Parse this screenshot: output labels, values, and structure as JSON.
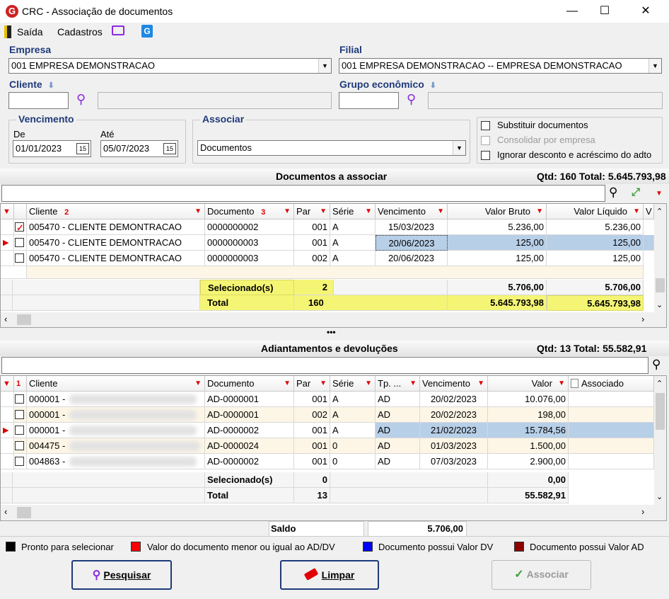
{
  "window": {
    "title": "CRC - Associação de documentos",
    "logo": "G"
  },
  "menu": {
    "exit": "Saída",
    "register": "Cadastros"
  },
  "form": {
    "empresa_label": "Empresa",
    "empresa_value": "001 EMPRESA DEMONSTRACAO",
    "filial_label": "Filial",
    "filial_value": "001 EMPRESA DEMONSTRACAO -- EMPRESA DEMONSTRACAO",
    "cliente_label": "Cliente",
    "grupo_label": "Grupo econômico",
    "vencimento_label": "Vencimento",
    "de_label": "De",
    "de_value": "01/01/2023",
    "ate_label": "Até",
    "ate_value": "05/07/2023",
    "associar_label": "Associar",
    "associar_value": "Documentos",
    "opt_substituir": "Substituir documentos",
    "opt_consolidar": "Consolidar por empresa",
    "opt_ignorar": "Ignorar desconto e acréscimo do adto",
    "cal_glyph": "15"
  },
  "docs": {
    "title": "Documentos a associar",
    "summary": "Qtd: 160 Total: 5.645.793,98",
    "headers": {
      "cliente": "Cliente",
      "cliente_sort": "2",
      "documento": "Documento",
      "doc_sort": "3",
      "par": "Par",
      "serie": "Série",
      "vencimento": "Vencimento",
      "valor_bruto": "Valor Bruto",
      "valor_liquido": "Valor Líquido",
      "next": "V"
    },
    "rows": [
      {
        "cliente": "005470 - CLIENTE DEMONTRACAO",
        "documento": "0000000002",
        "par": "001",
        "serie": "A",
        "vencimento": "15/03/2023",
        "bruto": "5.236,00",
        "liquido": "5.236,00"
      },
      {
        "cliente": "005470 - CLIENTE DEMONTRACAO",
        "documento": "0000000003",
        "par": "001",
        "serie": "A",
        "vencimento": "20/06/2023",
        "bruto": "125,00",
        "liquido": "125,00"
      },
      {
        "cliente": "005470 - CLIENTE DEMONTRACAO",
        "documento": "0000000003",
        "par": "002",
        "serie": "A",
        "vencimento": "20/06/2023",
        "bruto": "125,00",
        "liquido": "125,00"
      }
    ],
    "selected_label": "Selecionado(s)",
    "selected_count": "2",
    "selected_bruto": "5.706,00",
    "selected_liquido": "5.706,00",
    "total_label": "Total",
    "total_count": "160",
    "total_bruto": "5.645.793,98",
    "total_liquido": "5.645.793,98"
  },
  "splitter": "•••",
  "adto": {
    "title": "Adiantamentos e devoluções",
    "summary": "Qtd: 13 Total: 55.582,91",
    "headers": {
      "sort": "1",
      "cliente": "Cliente",
      "documento": "Documento",
      "par": "Par",
      "serie": "Série",
      "tp": "Tp. ...",
      "vencimento": "Vencimento",
      "valor": "Valor",
      "associado": "Associado"
    },
    "rows": [
      {
        "cliente": "000001 -",
        "documento": "AD-0000001",
        "par": "001",
        "serie": "A",
        "tp": "AD",
        "vencimento": "20/02/2023",
        "valor": "10.076,00"
      },
      {
        "cliente": "000001 -",
        "documento": "AD-0000001",
        "par": "002",
        "serie": "A",
        "tp": "AD",
        "vencimento": "20/02/2023",
        "valor": "198,00"
      },
      {
        "cliente": "000001 -",
        "documento": "AD-0000002",
        "par": "001",
        "serie": "A",
        "tp": "AD",
        "vencimento": "21/02/2023",
        "valor": "15.784,56"
      },
      {
        "cliente": "004475 -",
        "documento": "AD-0000024",
        "par": "001",
        "serie": "0",
        "tp": "AD",
        "vencimento": "01/03/2023",
        "valor": "1.500,00"
      },
      {
        "cliente": "004863 -",
        "documento": "AD-0000002",
        "par": "001",
        "serie": "0",
        "tp": "AD",
        "vencimento": "07/03/2023",
        "valor": "2.900,00"
      }
    ],
    "selected_label": "Selecionado(s)",
    "selected_count": "0",
    "selected_valor": "0,00",
    "total_label": "Total",
    "total_count": "13",
    "total_valor": "55.582,91"
  },
  "saldo": {
    "label": "Saldo",
    "value": "5.706,00"
  },
  "legend": [
    {
      "color": "#000000",
      "label": "Pronto para selecionar"
    },
    {
      "color": "#ff0000",
      "label": "Valor do documento menor ou igual ao AD/DV"
    },
    {
      "color": "#0000ff",
      "label": "Documento possui Valor DV"
    },
    {
      "color": "#8b0000",
      "label": "Documento possui Valor AD"
    }
  ],
  "buttons": {
    "search": "Pesquisar",
    "clear": "Limpar",
    "associate": "Associar"
  }
}
